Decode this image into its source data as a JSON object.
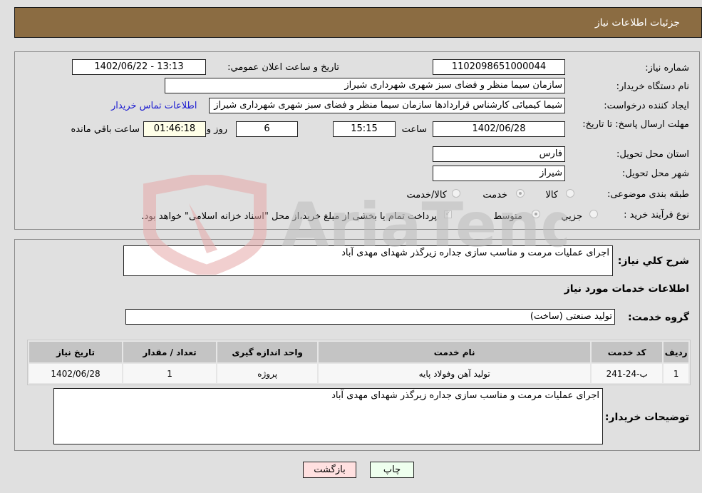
{
  "header": {
    "title": "جزئیات اطلاعات نیاز"
  },
  "details": {
    "need_number_label": "شماره نیاز:",
    "need_number": "1102098651000044",
    "announce_label": "تاریخ و ساعت اعلان عمومي:",
    "announce_value": "1402/06/22 - 13:13",
    "buyer_org_label": "نام دستگاه خریدار:",
    "buyer_org": "سازمان سیما منظر و فضای سبز شهری شهرداری شیراز",
    "creator_label": "ایجاد کننده درخواست:",
    "creator": "شیما کیمیائی کارشناس قراردادها سازمان سیما منظر و فضای سبز شهری شهرداری شیراز",
    "contact_link": "اطلاعات تماس خریدار",
    "deadline_label": "مهلت ارسال پاسخ: تا تاریخ:",
    "deadline_date": "1402/06/28",
    "time_label": "ساعت",
    "deadline_time": "15:15",
    "days_value": "6",
    "days_label": "روز و",
    "remaining_time": "01:46:18",
    "remaining_label": "ساعت باقي مانده",
    "province_label": "استان محل تحویل:",
    "province": "فارس",
    "city_label": "شهر محل تحویل:",
    "city": "شیراز",
    "category_label": "طبقه بندی موضوعی:",
    "category_options": [
      {
        "label": "کالا",
        "selected": false
      },
      {
        "label": "خدمت",
        "selected": true
      },
      {
        "label": "کالا/خدمت",
        "selected": false
      }
    ],
    "process_label": "نوع فرآیند خرید :",
    "process_options": [
      {
        "label": "جزيي",
        "selected": false
      },
      {
        "label": "متوسط",
        "selected": true
      }
    ],
    "payment_note": "پرداخت تمام یا بخشی از مبلغ خرید،از محل \"اسناد خزانه اسلامی\" خواهد بود.",
    "payment_checked": true
  },
  "services": {
    "description_label": "شرح كلي نياز:",
    "description": "اجرای عملیات مرمت و مناسب سازی جداره زیرگذر شهدای مهدی آباد",
    "section_title": "اطلاعات خدمات مورد نیاز",
    "group_label": "گروه خدمت:",
    "group_value": "تولید صنعتی (ساخت)",
    "table": {
      "headers": [
        "ردیف",
        "کد خدمت",
        "نام خدمت",
        "واحد اندازه گیری",
        "تعداد / مقدار",
        "تاریخ نیاز"
      ],
      "rows": [
        [
          "1",
          "ب-24-241",
          "تولید آهن وفولاد پایه",
          "پروژه",
          "1",
          "1402/06/28"
        ]
      ]
    },
    "buyer_notes_label": "توضیحات خریدار:",
    "buyer_notes": "اجرای عملیات مرمت و مناسب سازی جداره زیرگذر شهدای مهدی آباد"
  },
  "buttons": {
    "print": "چاپ",
    "back": "بازگشت"
  },
  "watermark": {
    "text": "AriaTender.net"
  }
}
